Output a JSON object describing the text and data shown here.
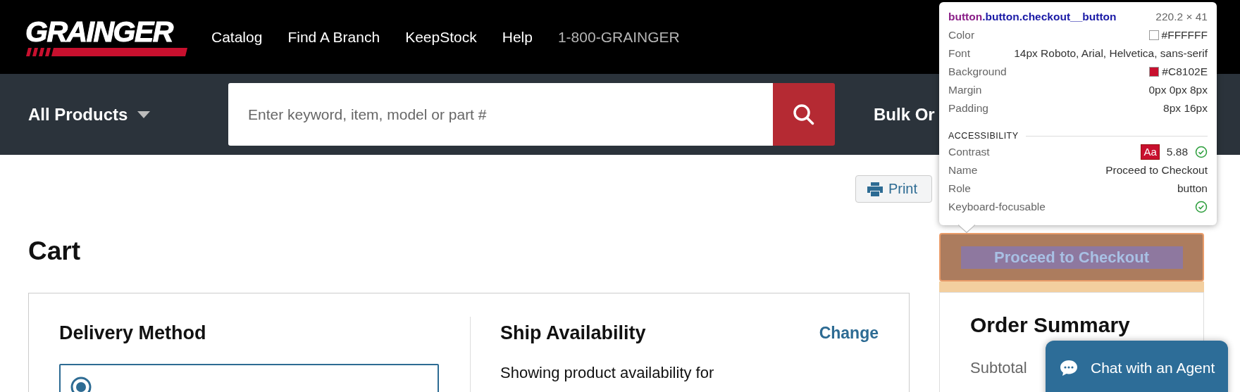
{
  "header": {
    "logo": "GRAINGER",
    "nav": [
      {
        "label": "Catalog",
        "kind": "link"
      },
      {
        "label": "Find A Branch",
        "kind": "link"
      },
      {
        "label": "KeepStock",
        "kind": "link"
      },
      {
        "label": "Help",
        "kind": "link"
      },
      {
        "label": "1-800-GRAINGER",
        "kind": "phone"
      }
    ]
  },
  "search_bar": {
    "category": "All Products",
    "placeholder": "Enter keyword, item, model or part #",
    "bulk_order": "Bulk Or"
  },
  "print_button": "Print",
  "page_title": "Cart",
  "delivery": {
    "title": "Delivery Method",
    "option_selected": true
  },
  "ship_availability": {
    "title": "Ship Availability",
    "change_link": "Change",
    "text": "Showing product availability for"
  },
  "checkout_button": "Proceed to Checkout",
  "order_summary": {
    "title": "Order Summary",
    "subtotal_label": "Subtotal"
  },
  "chat_button": "Chat with an Agent",
  "inspector": {
    "tag": "button",
    "classes": ".button.checkout__button",
    "size": "220.2 × 41",
    "rows": [
      {
        "label": "Color",
        "value": "#FFFFFF",
        "kind": "swatch",
        "color": "#ffffff"
      },
      {
        "label": "Font",
        "value": "14px Roboto, Arial, Helvetica, sans-serif",
        "kind": "text"
      },
      {
        "label": "Background",
        "value": "#C8102E",
        "kind": "swatch",
        "color": "#c8102e"
      },
      {
        "label": "Margin",
        "value": "0px 0px 8px",
        "kind": "text"
      },
      {
        "label": "Padding",
        "value": "8px 16px",
        "kind": "text"
      }
    ],
    "section": "ACCESSIBILITY",
    "a11y_rows": [
      {
        "label": "Contrast",
        "value": "5.88",
        "kind": "contrast",
        "sample": "Aa",
        "passed": true
      },
      {
        "label": "Name",
        "value": "Proceed to Checkout",
        "kind": "text"
      },
      {
        "label": "Role",
        "value": "button",
        "kind": "text"
      },
      {
        "label": "Keyboard-focusable",
        "kind": "check",
        "passed": true
      }
    ]
  }
}
